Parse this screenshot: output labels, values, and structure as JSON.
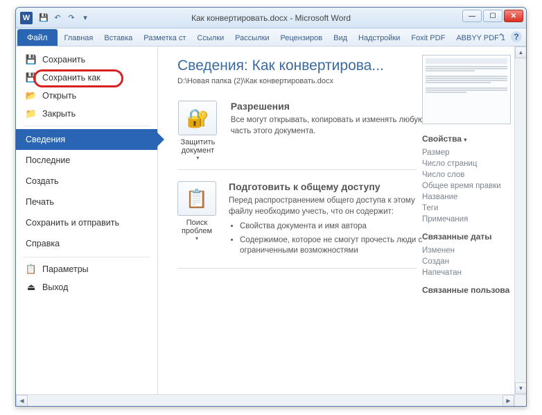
{
  "title": "Как конвертировать.docx - Microsoft Word",
  "tabs": {
    "file": "Файл",
    "home": "Главная",
    "insert": "Вставка",
    "layout": "Разметка ст",
    "refs": "Ссылки",
    "mail": "Рассылки",
    "review": "Рецензиров",
    "view": "Вид",
    "addins": "Надстройки",
    "foxit": "Foxit PDF",
    "abbyy": "ABBYY PDF 1"
  },
  "sidebar": {
    "save": "Сохранить",
    "saveas": "Сохранить как",
    "open": "Открыть",
    "close": "Закрыть",
    "info": "Сведения",
    "recent": "Последние",
    "new": "Создать",
    "print": "Печать",
    "share": "Сохранить и отправить",
    "help": "Справка",
    "options": "Параметры",
    "exit": "Выход"
  },
  "info": {
    "heading": "Сведения: Как конвертирова...",
    "path": "D:\\Новая папка (2)\\Как конвертировать.docx",
    "protect_btn": "Защитить документ",
    "perm_title": "Разрешения",
    "perm_text": "Все могут открывать, копировать и изменять любую часть этого документа.",
    "inspect_btn": "Поиск проблем",
    "share_title": "Подготовить к общему доступу",
    "share_text": "Перед распространением общего доступа к этому файлу необходимо учесть, что он содержит:",
    "share_b1": "Свойства документа и имя автора",
    "share_b2": "Содержимое, которое не смогут прочесть люди с ограниченными возможностями"
  },
  "props": {
    "heading": "Свойства",
    "size": "Размер",
    "pages": "Число страниц",
    "words": "Число слов",
    "edit_time": "Общее время правки",
    "title": "Название",
    "tags": "Теги",
    "comments": "Примечания",
    "dates_h": "Связанные даты",
    "modified": "Изменен",
    "created": "Создан",
    "printed": "Напечатан",
    "people_h": "Связанные пользова"
  }
}
